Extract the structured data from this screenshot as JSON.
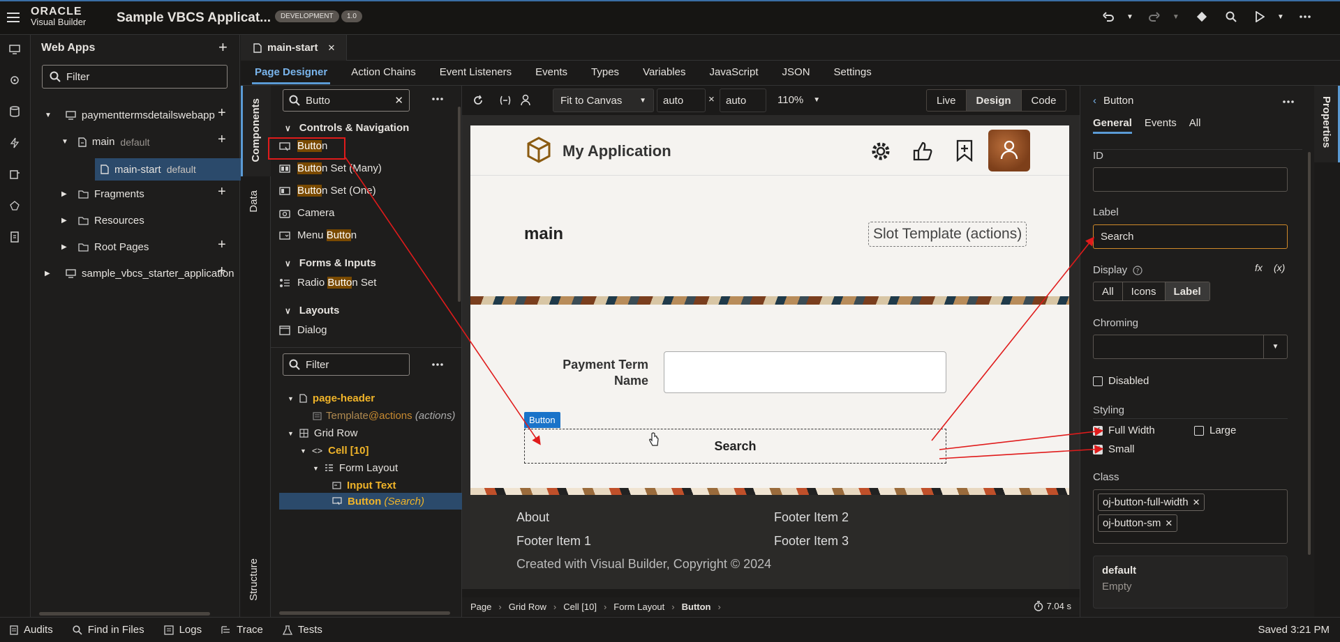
{
  "topbar": {
    "brand_line1": "ORACLE",
    "brand_line2": "Visual Builder",
    "app_title": "Sample VBCS Applicat...",
    "env_badge": "DEVELOPMENT",
    "version_badge": "1.0"
  },
  "webapps": {
    "title": "Web Apps",
    "filter_placeholder": "Filter",
    "tree": [
      {
        "label": "paymenttermsdetailswebapp"
      },
      {
        "label": "main",
        "tag": "default"
      },
      {
        "label": "main-start",
        "tag": "default"
      },
      {
        "label": "Fragments"
      },
      {
        "label": "Resources"
      },
      {
        "label": "Root Pages"
      },
      {
        "label": "sample_vbcs_starter_application"
      }
    ]
  },
  "editor": {
    "file_tab": "main-start",
    "tabs": [
      "Page Designer",
      "Action Chains",
      "Event Listeners",
      "Events",
      "Types",
      "Variables",
      "JavaScript",
      "JSON",
      "Settings"
    ]
  },
  "components": {
    "vtabs": [
      "Components",
      "Data",
      "Structure"
    ],
    "search_value": "Butto",
    "groups": {
      "controls": "Controls & Navigation",
      "forms": "Forms & Inputs",
      "layouts": "Layouts"
    },
    "items": {
      "button": {
        "pre": "",
        "match": "Butto",
        "post": "n"
      },
      "button_set_many": {
        "pre": "",
        "match": "Butto",
        "post": "n Set (Many)"
      },
      "button_set_one": {
        "pre": "",
        "match": "Butto",
        "post": "n Set (One)"
      },
      "camera": "Camera",
      "menu_button": {
        "pre": "Menu ",
        "match": "Butto",
        "post": "n"
      },
      "radio_button_set": {
        "pre": "Radio ",
        "match": "Butto",
        "post": "n Set"
      },
      "dialog": "Dialog"
    }
  },
  "structure": {
    "filter_placeholder": "Filter",
    "nodes": {
      "page_header": "page-header",
      "template": "Template",
      "template_at": "@actions",
      "template_note": "(actions)",
      "grid_row": "Grid Row",
      "cell": "Cell [10]",
      "form_layout": "Form Layout",
      "input_text": "Input Text",
      "button": "Button",
      "button_note": "(Search)"
    }
  },
  "canvas_toolbar": {
    "fit": "Fit to Canvas",
    "width": "auto",
    "height": "auto",
    "times": "×",
    "zoom": "110%",
    "modes": [
      "Live",
      "Design",
      "Code"
    ]
  },
  "preview": {
    "app_name": "My Application",
    "page_title": "main",
    "slot_template": "Slot Template (actions)",
    "field_label_1": "Payment Term",
    "field_label_2": "Name",
    "button_tag": "Button",
    "button_label": "Search",
    "footer": {
      "about": "About",
      "item1": "Footer Item 1",
      "item2": "Footer Item 2",
      "item3": "Footer Item 3",
      "copyright": "Created with Visual Builder, Copyright © 2024"
    }
  },
  "breadcrumb": [
    "Page",
    "Grid Row",
    "Cell [10]",
    "Form Layout",
    "Button"
  ],
  "timer": "7.04 s",
  "properties": {
    "vtab": "Properties",
    "back_title": "Button",
    "tabs": [
      "General",
      "Events",
      "All"
    ],
    "id_label": "ID",
    "id_value": "",
    "label_label": "Label",
    "label_value": "Search",
    "display_label": "Display",
    "fx": "fx",
    "var": "(x)",
    "display_options": [
      "All",
      "Icons",
      "Label"
    ],
    "chroming_label": "Chroming",
    "chroming_value": "",
    "disabled": "Disabled",
    "styling_label": "Styling",
    "full_width": "Full Width",
    "large": "Large",
    "small": "Small",
    "class_label": "Class",
    "classes": [
      "oj-button-full-width",
      "oj-button-sm"
    ],
    "default_title": "default",
    "default_value": "Empty"
  },
  "statusbar": {
    "items": [
      "Audits",
      "Find in Files",
      "Logs",
      "Trace",
      "Tests"
    ],
    "saved": "Saved 3:21 PM"
  },
  "colors": {
    "accent": "#5b9bd5",
    "highlight": "#7a4a00",
    "selected": "#2b4a6b",
    "annotation": "#e01b1b"
  }
}
